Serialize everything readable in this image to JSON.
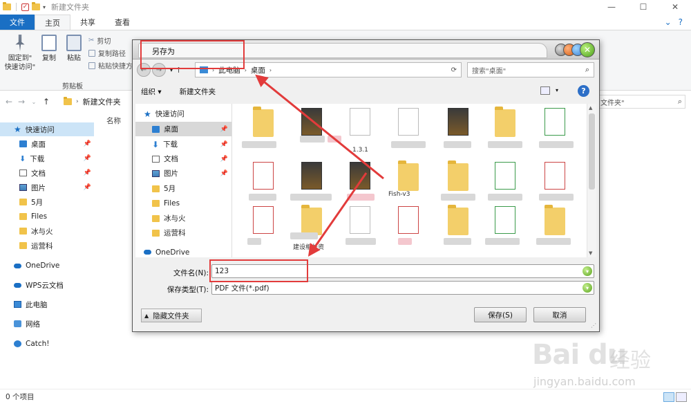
{
  "explorer": {
    "title": "新建文件夹",
    "tabs": {
      "file": "文件",
      "home": "主页",
      "share": "共享",
      "view": "查看"
    },
    "ribbon": {
      "pin_label": "固定到\"\n快速访问\"",
      "pin_line1": "固定到\"",
      "pin_line2": "快速访问\"",
      "copy": "复制",
      "paste": "粘贴",
      "cut": "剪切",
      "copy_path": "复制路径",
      "paste_shortcut": "粘贴快捷方",
      "group_clipboard": "剪贴板"
    },
    "path": "新建文件夹",
    "search_placeholder": "文件夹\"",
    "column_name": "名称",
    "sidebar": {
      "quick_access": "快速访问",
      "items": [
        "桌面",
        "下载",
        "文档",
        "图片",
        "5月",
        "Files",
        "冰与火",
        "运营科"
      ],
      "onedrive": "OneDrive",
      "wps": "WPS云文档",
      "this_pc": "此电脑",
      "network": "网络",
      "catch": "Catch!"
    },
    "status": "0 个项目"
  },
  "dialog": {
    "title": "另存为",
    "path": {
      "this_pc": "此电脑",
      "desktop": "桌面"
    },
    "search_placeholder": "搜索\"桌面\"",
    "toolbar": {
      "organize": "组织 ▾",
      "new_folder": "新建文件夹"
    },
    "side": {
      "quick_access": "快速访问",
      "items": [
        "桌面",
        "下载",
        "文档",
        "图片",
        "5月",
        "Files",
        "冰与火",
        "运营科"
      ],
      "onedrive": "OneDrive"
    },
    "file_labels": [
      "1.3.1",
      "Fish-v3",
      "建设相关资"
    ],
    "filename_label": "文件名(N):",
    "filename_value": "123",
    "filetype_label": "保存类型(T):",
    "filetype_value": "PDF 文件(*.pdf)",
    "hide_folders": "隐藏文件夹",
    "save": "保存(S)",
    "cancel": "取消"
  },
  "watermark": {
    "brand": "Bai du",
    "cn": "经验",
    "url": "jingyan.baidu.com"
  },
  "colors": {
    "accent": "#1a6fc4",
    "annotation": "#e23b3b"
  }
}
